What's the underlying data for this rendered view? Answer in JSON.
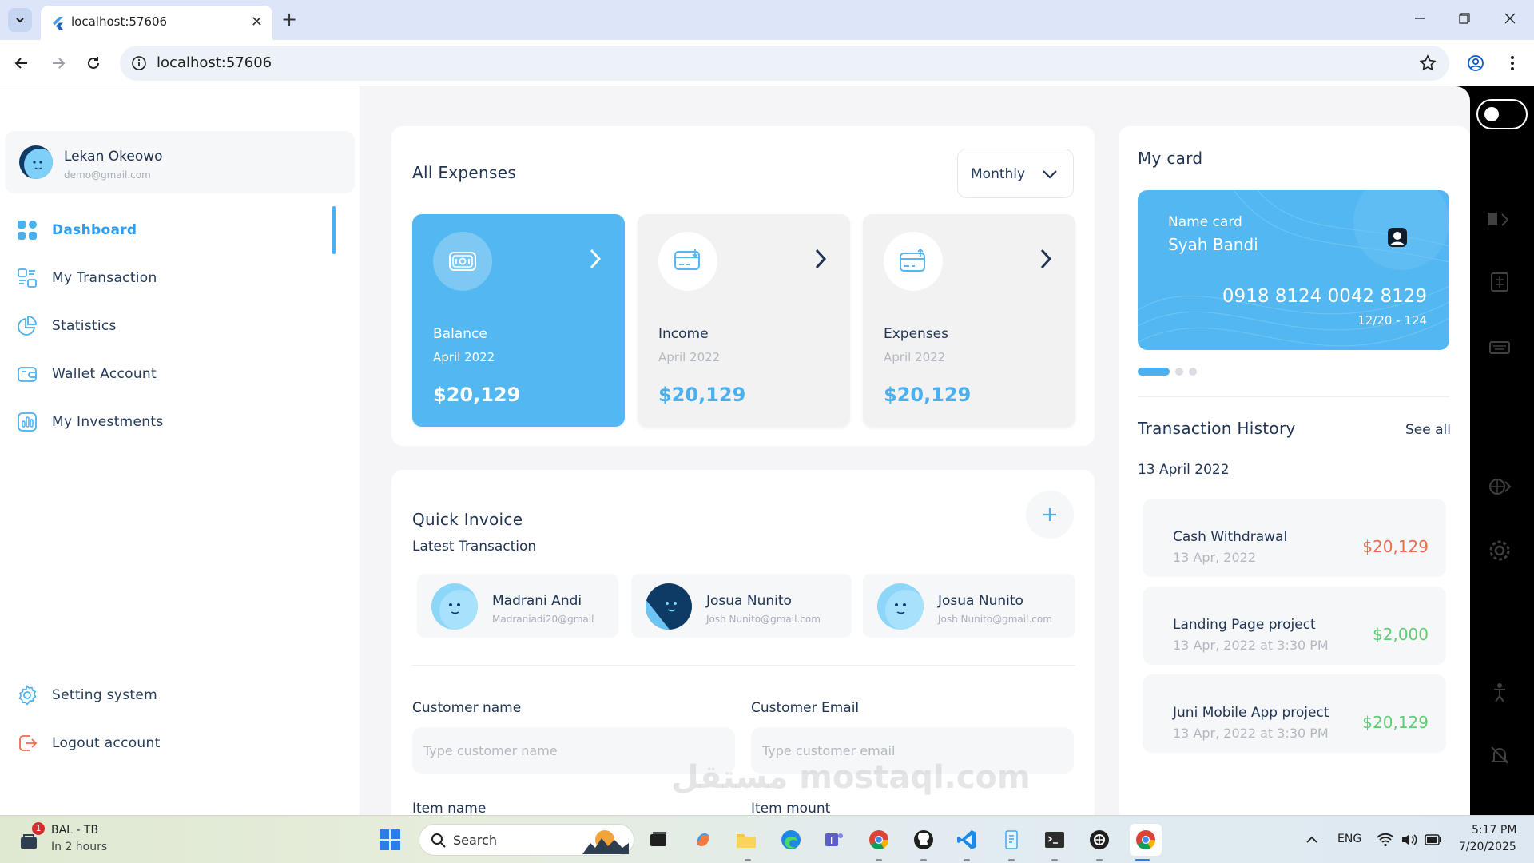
{
  "browser": {
    "tab_title": "localhost:57606",
    "url": "localhost:57606"
  },
  "user": {
    "name": "Lekan Okeowo",
    "email": "demo@gmail.com"
  },
  "nav": {
    "items": [
      {
        "label": "Dashboard",
        "icon": "grid-icon"
      },
      {
        "label": "My Transaction",
        "icon": "transaction-icon"
      },
      {
        "label": "Statistics",
        "icon": "pie-chart-icon"
      },
      {
        "label": "Wallet Account",
        "icon": "wallet-icon"
      },
      {
        "label": "My Investments",
        "icon": "bar-chart-icon"
      }
    ],
    "bottom": [
      {
        "label": "Setting system",
        "icon": "gear-icon"
      },
      {
        "label": "Logout account",
        "icon": "logout-icon"
      }
    ]
  },
  "expenses": {
    "title": "All Expenses",
    "period": "Monthly",
    "cards": [
      {
        "name": "Balance",
        "date": "April 2022",
        "amount": "$20,129"
      },
      {
        "name": "Income",
        "date": "April 2022",
        "amount": "$20,129"
      },
      {
        "name": "Expenses",
        "date": "April 2022",
        "amount": "$20,129"
      }
    ]
  },
  "invoice": {
    "title": "Quick Invoice",
    "subtitle": "Latest Transaction",
    "people": [
      {
        "name": "Madrani Andi",
        "email": "Madraniadi20@gmail"
      },
      {
        "name": "Josua Nunito",
        "email": "Josh Nunito@gmail.com"
      },
      {
        "name": "Josua Nunito",
        "email": "Josh Nunito@gmail.com"
      }
    ],
    "customer_name_label": "Customer name",
    "customer_name_placeholder": "Type customer name",
    "customer_email_label": "Customer Email",
    "customer_email_placeholder": "Type customer email",
    "item_name_label": "Item name",
    "item_mount_label": "Item mount"
  },
  "card": {
    "title": "My card",
    "name_label": "Name card",
    "holder": "Syah Bandi",
    "number": "0918 8124 0042 8129",
    "expiry": "12/20 - 124"
  },
  "history": {
    "title": "Transaction History",
    "see_all": "See all",
    "date": "13 April 2022",
    "items": [
      {
        "name": "Cash Withdrawal",
        "sub": "13 Apr, 2022",
        "amount": "$20,129",
        "type": "debit"
      },
      {
        "name": "Landing Page project",
        "sub": "13 Apr, 2022 at 3:30 PM",
        "amount": "$2,000",
        "type": "credit"
      },
      {
        "name": "Juni Mobile App project",
        "sub": "13 Apr, 2022 at 3:30 PM",
        "amount": "$20,129",
        "type": "credit"
      }
    ]
  },
  "watermark": "مستقل mostaql.com",
  "taskbar": {
    "notification_count": "1",
    "widget_title": "BAL - TB",
    "widget_sub": "In 2 hours",
    "search_label": "Search",
    "lang": "ENG",
    "time": "5:17 PM",
    "date": "7/20/2025"
  },
  "colors": {
    "accent": "#53b7f1",
    "debit": "#ee6a4d",
    "credit": "#5fcd74"
  }
}
